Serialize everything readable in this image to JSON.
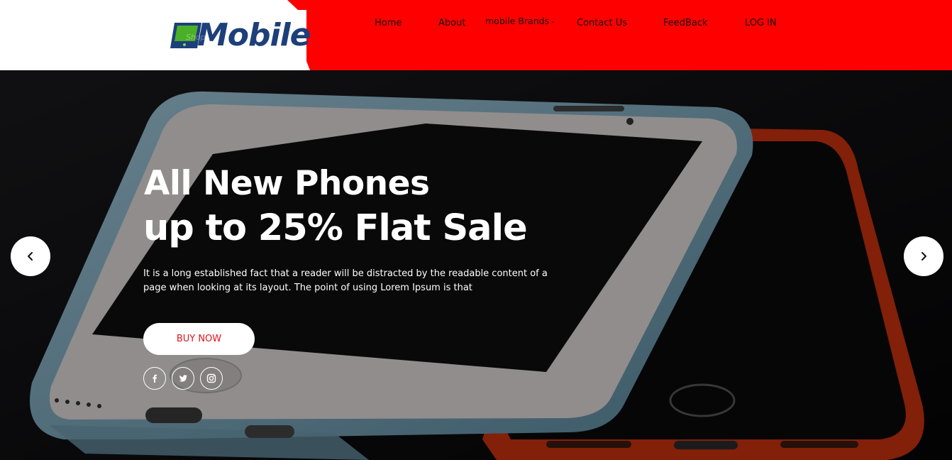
{
  "brand": {
    "logo_text": "Mobile",
    "tag_text": "Shop"
  },
  "nav": {
    "items": [
      {
        "label": "Home"
      },
      {
        "label": "About"
      },
      {
        "label": "mobile Brands",
        "caret": "⌄"
      },
      {
        "label": "Contact Us"
      },
      {
        "label": "FeedBack"
      },
      {
        "label": "LOG IN"
      }
    ]
  },
  "hero": {
    "headline_line1": "All New Phones",
    "headline_line2": "up to 25% Flat Sale",
    "description": "It is a long established fact that a reader will be distracted by the readable content of a page when looking at its layout. The point of using Lorem Ipsum is that",
    "cta_label": "BUY NOW",
    "social": [
      {
        "name": "facebook-icon",
        "glyph": "f"
      },
      {
        "name": "twitter-icon",
        "glyph": ""
      },
      {
        "name": "instagram-icon",
        "glyph": ""
      }
    ],
    "prev_icon": "‹",
    "next_icon": "›"
  },
  "colors": {
    "header_accent": "#ff0000",
    "logo_blue": "#1d3f7a",
    "cta_text": "#e0141a",
    "hero_bg": "#0b0a0c"
  }
}
